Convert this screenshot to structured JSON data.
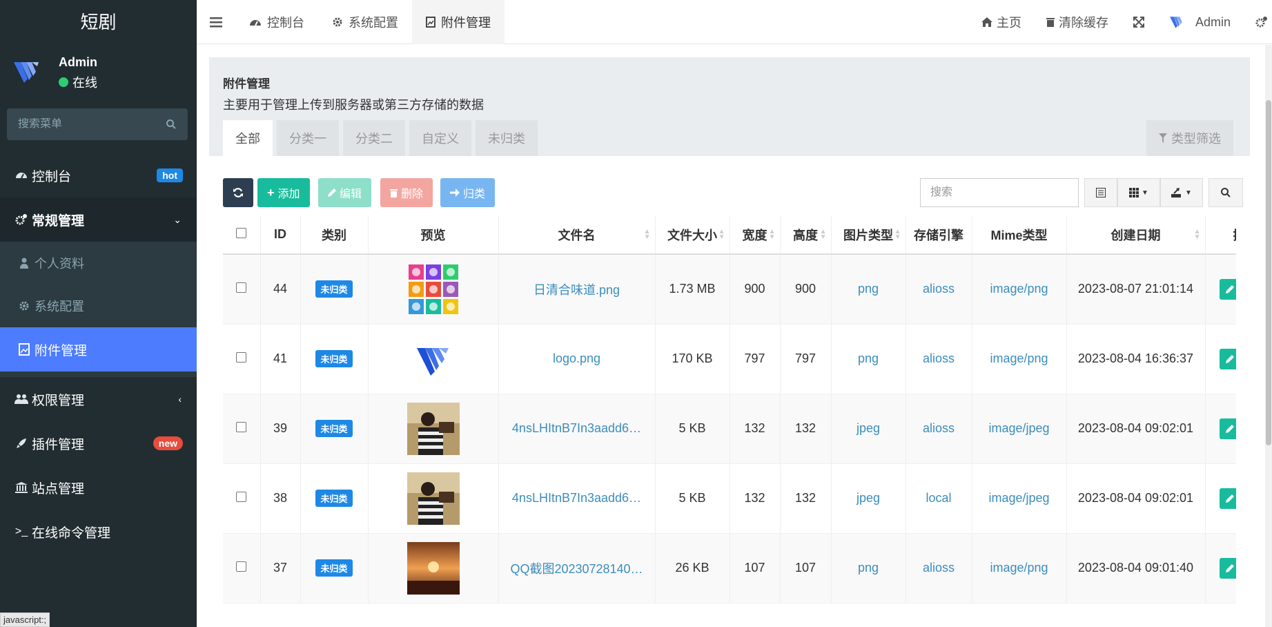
{
  "brand": "短剧",
  "user": {
    "name": "Admin",
    "status": "在线"
  },
  "sidebar": {
    "search_placeholder": "搜索菜单",
    "items": [
      {
        "label": "控制台",
        "badge": "hot"
      },
      {
        "label": "常规管理"
      },
      {
        "label": "个人资料"
      },
      {
        "label": "系统配置"
      },
      {
        "label": "附件管理"
      },
      {
        "label": "权限管理"
      },
      {
        "label": "插件管理",
        "badge": "new"
      },
      {
        "label": "站点管理"
      },
      {
        "label": "在线命令管理"
      }
    ]
  },
  "status_tip": "javascript:;",
  "topbar": {
    "tabs": [
      "控制台",
      "系统配置",
      "附件管理"
    ],
    "home": "主页",
    "clear_cache": "清除缓存",
    "admin": "Admin"
  },
  "panel": {
    "title": "附件管理",
    "desc": "主要用于管理上传到服务器或第三方存储的数据",
    "tabs": [
      "全部",
      "分类一",
      "分类二",
      "自定义",
      "未归类"
    ],
    "filter": "类型筛选"
  },
  "toolbar": {
    "add": "添加",
    "edit": "编辑",
    "delete": "删除",
    "classify": "归类",
    "search_placeholder": "搜索"
  },
  "table": {
    "headers": [
      "ID",
      "类别",
      "预览",
      "文件名",
      "文件大小",
      "宽度",
      "高度",
      "图片类型",
      "存储引擎",
      "Mime类型",
      "创建日期",
      "操"
    ],
    "rows": [
      {
        "id": "44",
        "category": "未归类",
        "preview": "candy",
        "filename": "日清合味道.png",
        "size": "1.73 MB",
        "width": "900",
        "height": "900",
        "imagetype": "png",
        "storage": "alioss",
        "mime": "image/png",
        "created": "2023-08-07 21:01:14"
      },
      {
        "id": "41",
        "category": "未归类",
        "preview": "logo",
        "filename": "logo.png",
        "size": "170 KB",
        "width": "797",
        "height": "797",
        "imagetype": "png",
        "storage": "alioss",
        "mime": "image/png",
        "created": "2023-08-04 16:36:37"
      },
      {
        "id": "39",
        "category": "未归类",
        "preview": "photo",
        "filename": "4nsLHItnB7In3aadd6…",
        "size": "5 KB",
        "width": "132",
        "height": "132",
        "imagetype": "jpeg",
        "storage": "alioss",
        "mime": "image/jpeg",
        "created": "2023-08-04 09:02:01"
      },
      {
        "id": "38",
        "category": "未归类",
        "preview": "photo",
        "filename": "4nsLHItnB7In3aadd6…",
        "size": "5 KB",
        "width": "132",
        "height": "132",
        "imagetype": "jpeg",
        "storage": "local",
        "mime": "image/jpeg",
        "created": "2023-08-04 09:02:01"
      },
      {
        "id": "37",
        "category": "未归类",
        "preview": "sunset",
        "filename": "QQ截图20230728140…",
        "size": "26 KB",
        "width": "107",
        "height": "107",
        "imagetype": "png",
        "storage": "alioss",
        "mime": "image/png",
        "created": "2023-08-04 09:01:40"
      }
    ]
  },
  "colors": {
    "sidebar": "#222d32",
    "active": "#4d7cff",
    "success": "#18bc9c",
    "link": "#3c8dbc",
    "tag": "#1e88e5"
  }
}
